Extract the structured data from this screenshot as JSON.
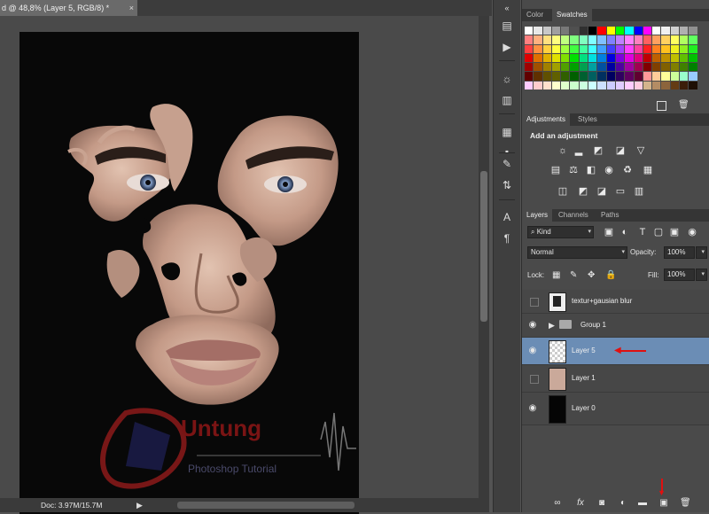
{
  "document": {
    "tab_title": "d @ 48,8% (Layer 5, RGB/8) *",
    "close_glyph": "×",
    "status": "Doc: 3.97M/15.7M",
    "status_arrow": "▶"
  },
  "watermark": {
    "text": "Untung",
    "subtext": "Photoshop Tutorial"
  },
  "tools": [
    "chevron-icon",
    "play-icon",
    "sun-icon",
    "levels-icon",
    "brush-settings-icon",
    "clone-source-icon",
    "type-icon",
    "paragraph-icon"
  ],
  "color_panel": {
    "tabs": [
      {
        "label": "Color",
        "active": false
      },
      {
        "label": "Swatches",
        "active": true
      }
    ]
  },
  "adjustments_panel": {
    "tabs": [
      {
        "label": "Adjustments",
        "active": true
      },
      {
        "label": "Styles",
        "active": false
      }
    ],
    "heading": "Add an adjustment"
  },
  "layers_panel": {
    "tabs": [
      {
        "label": "Layers",
        "active": true
      },
      {
        "label": "Channels",
        "active": false
      },
      {
        "label": "Paths",
        "active": false
      }
    ],
    "filter": "Kind",
    "blend_mode": "Normal",
    "opacity_label": "Opacity:",
    "opacity_value": "100%",
    "lock_label": "Lock:",
    "fill_label": "Fill:",
    "fill_value": "100%",
    "layers": [
      {
        "name": "textur+gausian blur",
        "visible": false,
        "selected": false,
        "type": "smart"
      },
      {
        "name": "Group 1",
        "visible": true,
        "selected": false,
        "type": "group"
      },
      {
        "name": "Layer 5",
        "visible": true,
        "selected": true,
        "type": "transparent"
      },
      {
        "name": "Layer 1",
        "visible": false,
        "selected": false,
        "type": "photo"
      },
      {
        "name": "Layer 0",
        "visible": true,
        "selected": false,
        "type": "black"
      }
    ],
    "bottom_icons": [
      "link-icon",
      "fx-icon",
      "mask-icon",
      "adjustment-icon",
      "folder-icon",
      "new-layer-icon",
      "trash-icon"
    ]
  },
  "colors": {
    "selected_layer": "#6b8db5",
    "annotation_red": "#e01010"
  }
}
